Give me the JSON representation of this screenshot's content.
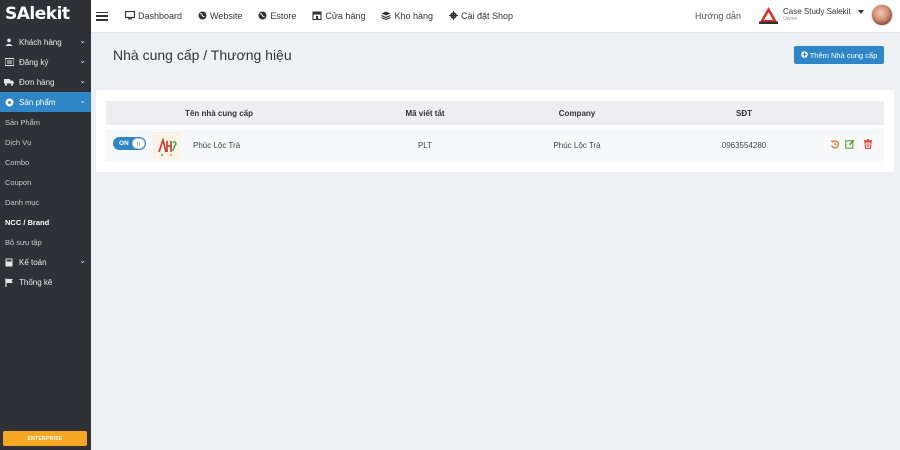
{
  "app": {
    "logo": "SAlekit"
  },
  "sidebar": {
    "items": [
      {
        "label": "Khách hàng",
        "icon": "user-icon",
        "has_chevron": true
      },
      {
        "label": "Đăng ký",
        "icon": "list-icon",
        "has_chevron": true
      },
      {
        "label": "Đơn hàng",
        "icon": "truck-icon",
        "has_chevron": true
      },
      {
        "label": "Sản phẩm",
        "icon": "gear-icon",
        "has_chevron": true,
        "active": true
      },
      {
        "label": "Kế toán",
        "icon": "calculator-icon",
        "has_chevron": true
      },
      {
        "label": "Thống kê",
        "icon": "flag-icon",
        "has_chevron": false
      }
    ],
    "subitems": [
      "Sản Phẩm",
      "Dịch Vụ",
      "Combo",
      "Coupon",
      "Danh mục",
      "NCC / Brand",
      "Bộ sưu tập"
    ],
    "current_subitem": "NCC / Brand",
    "enterprise_label": "ENTERPRISE"
  },
  "topbar": {
    "nav": [
      {
        "label": "Dashboard",
        "icon": "monitor-icon"
      },
      {
        "label": "Website",
        "icon": "globe-icon"
      },
      {
        "label": "Estore",
        "icon": "globe-icon"
      },
      {
        "label": "Cửa hàng",
        "icon": "store-icon"
      },
      {
        "label": "Kho hàng",
        "icon": "stack-icon"
      },
      {
        "label": "Cài đặt Shop",
        "icon": "gear-icon"
      }
    ],
    "help": "Hướng dẫn",
    "account_name": "Case Study Salekit",
    "account_role": "Owner"
  },
  "main": {
    "title": "Nhà cung cấp / Thương hiệu",
    "add_button": "Thêm Nhà cung cấp",
    "columns": [
      "Tên nhà cung cấp",
      "Mã viết tắt",
      "Company",
      "SĐT"
    ],
    "rows": [
      {
        "toggle": "ON",
        "enabled": true,
        "name": "Phúc Lộc Trà",
        "code": "PLT",
        "company": "Phúc Lộc Trà",
        "phone": "0963554280"
      }
    ]
  },
  "colors": {
    "sidebar_bg": "#2f3136",
    "accent": "#2f86c6",
    "enterprise": "#f5a623",
    "restore": "#e8732c",
    "edit": "#5aa02c",
    "delete": "#e0463a"
  }
}
